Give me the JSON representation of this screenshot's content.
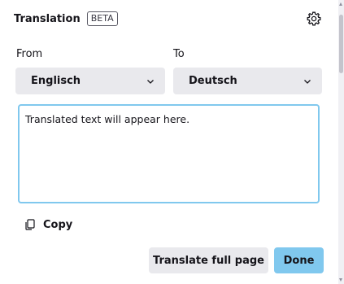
{
  "header": {
    "title": "Translation",
    "badge": "BETA",
    "settings_icon": "gear-icon"
  },
  "from": {
    "label": "From",
    "selected": "Englisch"
  },
  "to": {
    "label": "To",
    "selected": "Deutsch"
  },
  "output": {
    "placeholder": "Translated text will appear here."
  },
  "copy": {
    "label": "Copy",
    "icon": "copy-icon"
  },
  "footer": {
    "translate_full_page": "Translate full page",
    "done": "Done"
  },
  "colors": {
    "accent": "#80c8ee",
    "button_bg": "#e9e9ed",
    "text": "#15141a"
  }
}
